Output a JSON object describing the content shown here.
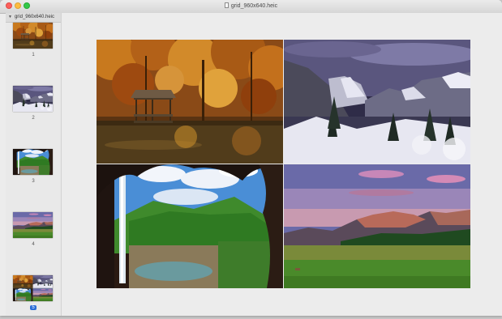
{
  "window": {
    "title": "grid_960x640.heic"
  },
  "sidebar": {
    "header_label": "grid_960x640.heic",
    "pages": [
      {
        "number": "1",
        "scene": "autumn-forest-cabin"
      },
      {
        "number": "2",
        "scene": "snowy-mountain-valley"
      },
      {
        "number": "3",
        "scene": "waterfall-cave"
      },
      {
        "number": "4",
        "scene": "mountain-meadow-sunset"
      },
      {
        "number": "5",
        "scene": "image-grid",
        "selected": true
      }
    ]
  },
  "grid": {
    "tiles": [
      {
        "scene": "autumn-forest-cabin"
      },
      {
        "scene": "snowy-mountain-valley"
      },
      {
        "scene": "waterfall-cave"
      },
      {
        "scene": "mountain-meadow-sunset"
      }
    ]
  },
  "colors": {
    "close": "#fc605c",
    "minimize": "#fdbc40",
    "zoom": "#34c84a",
    "selection": "#2a6cd6"
  }
}
